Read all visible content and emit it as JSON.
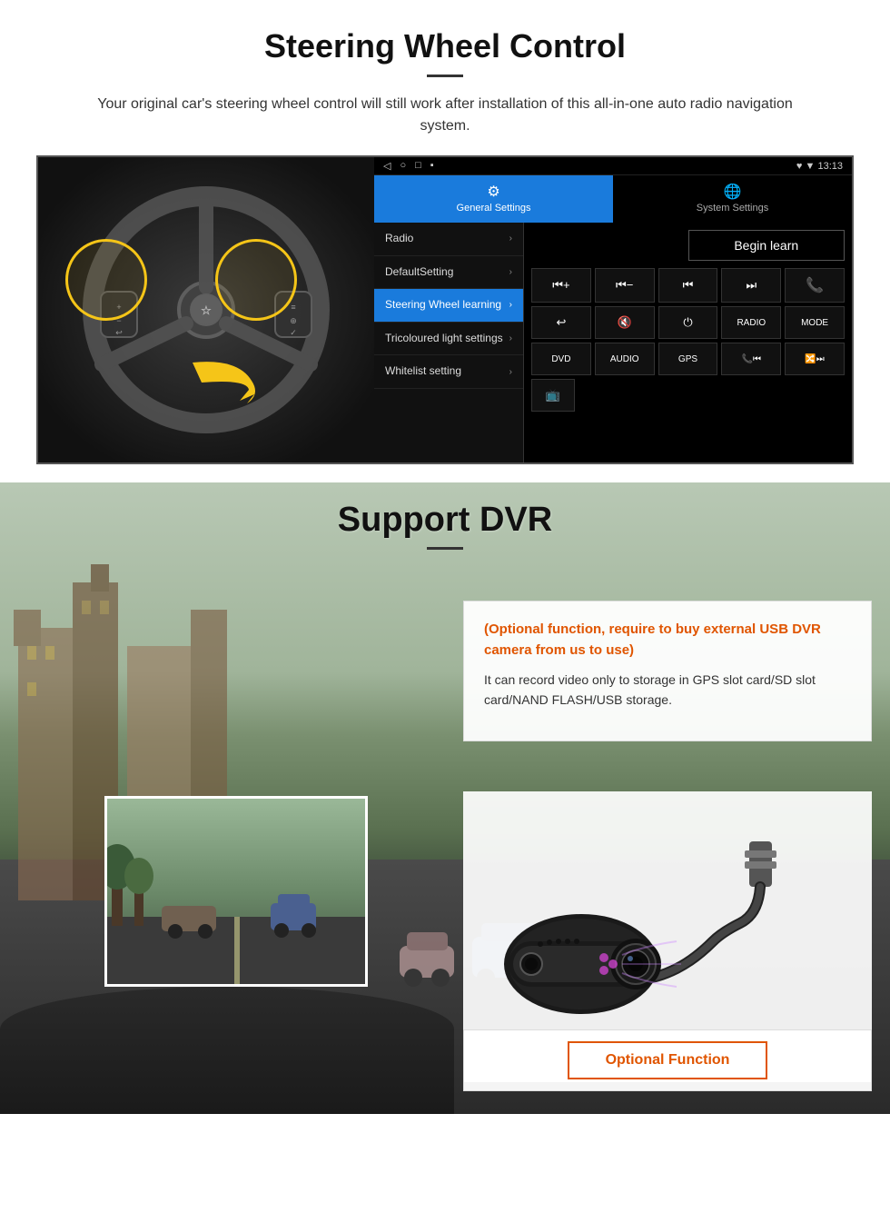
{
  "steering": {
    "title": "Steering Wheel Control",
    "subtitle": "Your original car's steering wheel control will still work after installation of this all-in-one auto radio navigation system.",
    "statusbar": {
      "nav_icons": "◁  ○  □  ▪",
      "time": "13:13",
      "signal": "♥ ▼"
    },
    "tabs": [
      {
        "label": "General Settings",
        "icon": "⚙",
        "active": true
      },
      {
        "label": "System Settings",
        "icon": "🌐",
        "active": false
      }
    ],
    "menu_items": [
      {
        "label": "Radio",
        "active": false
      },
      {
        "label": "DefaultSetting",
        "active": false
      },
      {
        "label": "Steering Wheel learning",
        "active": true
      },
      {
        "label": "Tricoloured light settings",
        "active": false
      },
      {
        "label": "Whitelist setting",
        "active": false
      }
    ],
    "begin_learn_label": "Begin learn",
    "control_buttons": [
      "⏮+",
      "⏮−",
      "⏮⏮",
      "⏭⏭",
      "📞",
      "↩",
      "🔇×",
      "⏻",
      "RADIO",
      "MODE",
      "DVD",
      "AUDIO",
      "GPS",
      "📞⏮",
      "🔀⏭"
    ],
    "extra_button": "📺"
  },
  "dvr": {
    "title": "Support DVR",
    "optional_text": "(Optional function, require to buy external USB DVR camera from us to use)",
    "desc_text": "It can record video only to storage in GPS slot card/SD slot card/NAND FLASH/USB storage.",
    "opt_function_label": "Optional Function"
  }
}
